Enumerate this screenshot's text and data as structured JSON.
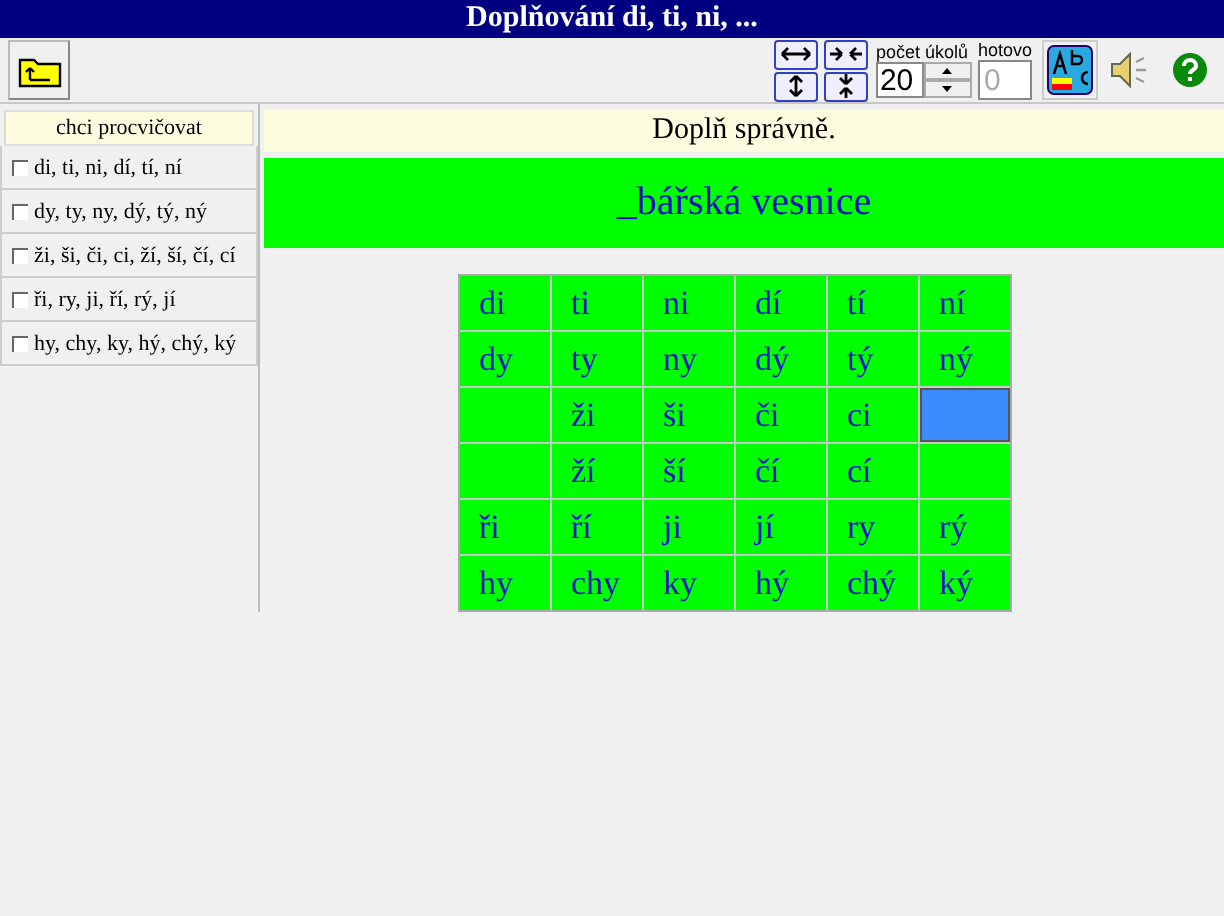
{
  "window": {
    "title": "Doplňování di, ti, ni, ..."
  },
  "toolbar": {
    "task_count": {
      "label": "počet úkolů",
      "value": "20"
    },
    "done": {
      "label": "hotovo",
      "placeholder": "0"
    }
  },
  "sidebar": {
    "header": "chci procvičovat",
    "items": [
      {
        "label": "di, ti, ni, dí, tí, ní",
        "checked": false
      },
      {
        "label": "dy, ty, ny, dý, tý, ný",
        "checked": false
      },
      {
        "label": "ži, ši, či, ci, ží, ší, čí, cí",
        "checked": false
      },
      {
        "label": "ři, ry, ji, ří, rý, jí",
        "checked": false
      },
      {
        "label": "hy, chy, ky, hý, chý, ký",
        "checked": false
      }
    ]
  },
  "exercise": {
    "instruction": "Doplň správně.",
    "word": "_bářská vesnice",
    "grid": [
      [
        {
          "text": "di",
          "selected": false
        },
        {
          "text": "ti",
          "selected": false
        },
        {
          "text": "ni",
          "selected": false
        },
        {
          "text": "dí",
          "selected": false
        },
        {
          "text": "tí",
          "selected": false
        },
        {
          "text": "ní",
          "selected": false
        }
      ],
      [
        {
          "text": "dy",
          "selected": false
        },
        {
          "text": "ty",
          "selected": false
        },
        {
          "text": "ny",
          "selected": false
        },
        {
          "text": "dý",
          "selected": false
        },
        {
          "text": "tý",
          "selected": false
        },
        {
          "text": "ný",
          "selected": false
        }
      ],
      [
        {
          "selected": false
        },
        {
          "text": "ži",
          "selected": false
        },
        {
          "text": "ši",
          "selected": false
        },
        {
          "text": "či",
          "selected": false
        },
        {
          "text": "ci",
          "selected": false
        },
        {
          "selected": true
        }
      ],
      [
        {
          "selected": false
        },
        {
          "text": "ží",
          "selected": false
        },
        {
          "text": "ší",
          "selected": false
        },
        {
          "text": "čí",
          "selected": false
        },
        {
          "text": "cí",
          "selected": false
        },
        {
          "selected": false
        }
      ],
      [
        {
          "text": "ři",
          "selected": false
        },
        {
          "text": "ří",
          "selected": false
        },
        {
          "text": "ji",
          "selected": false
        },
        {
          "text": "jí",
          "selected": false
        },
        {
          "text": "ry",
          "selected": false
        },
        {
          "text": "rý",
          "selected": false
        }
      ],
      [
        {
          "text": "hy",
          "selected": false
        },
        {
          "text": "chy",
          "selected": false
        },
        {
          "text": "ky",
          "selected": false
        },
        {
          "text": "hý",
          "selected": false
        },
        {
          "text": "chý",
          "selected": false
        },
        {
          "text": "ký",
          "selected": false
        }
      ]
    ]
  }
}
